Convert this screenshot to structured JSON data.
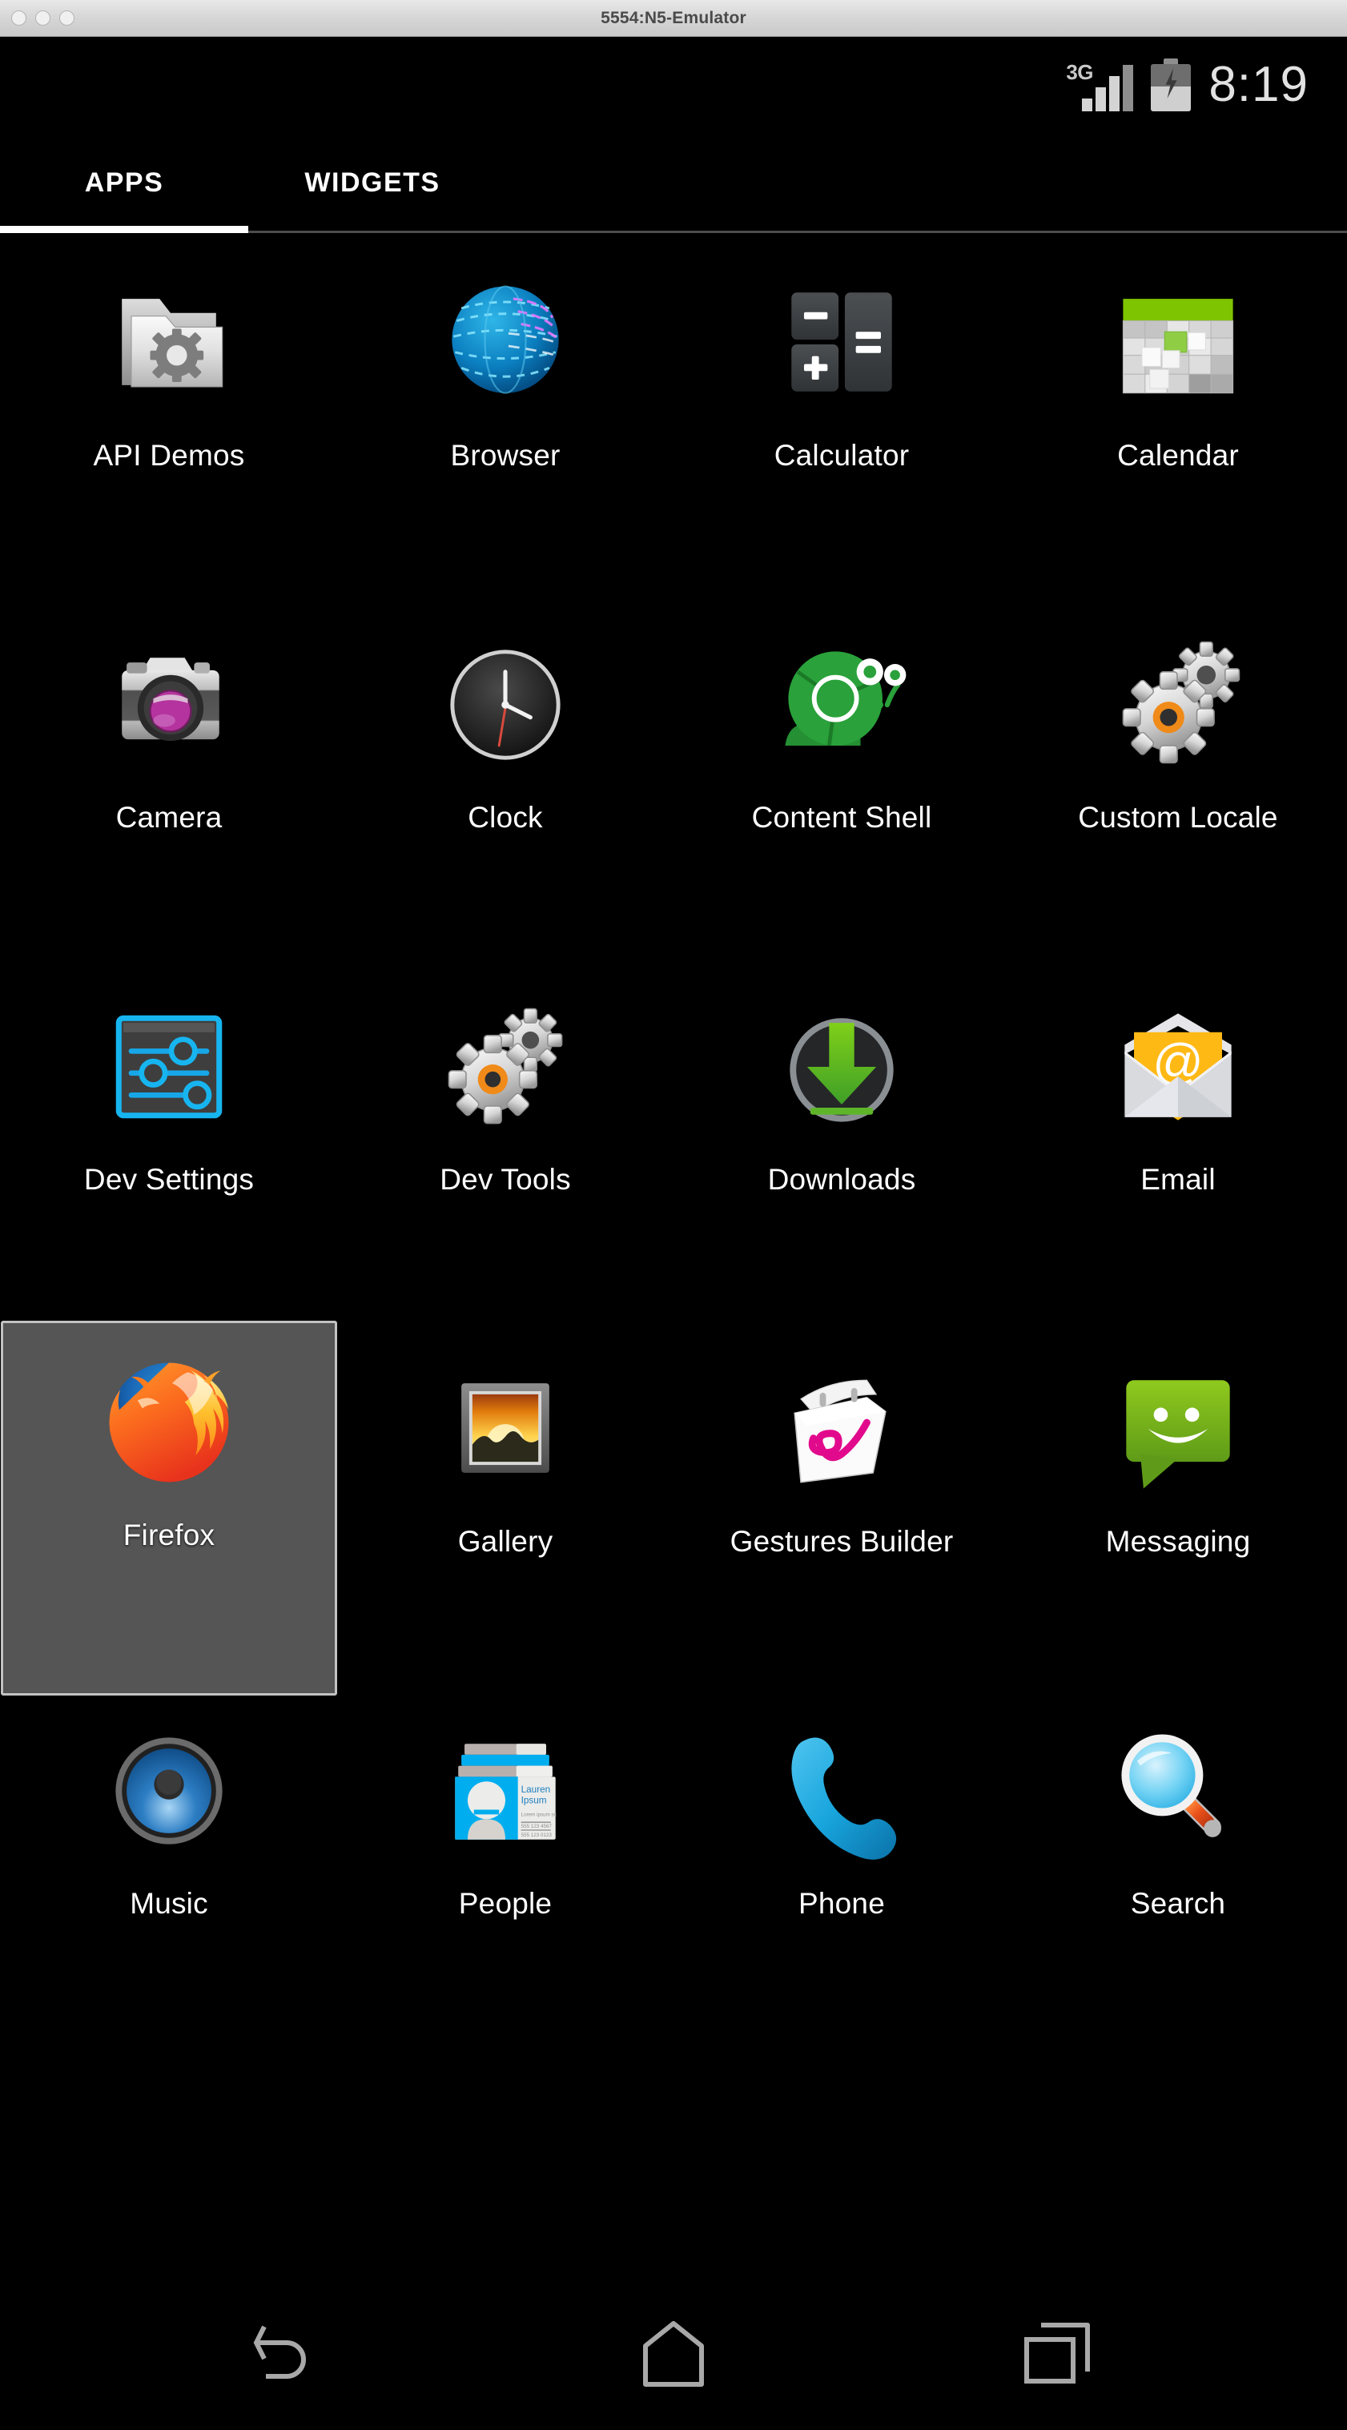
{
  "window": {
    "title": "5554:N5-Emulator",
    "traffic_lights": [
      "close",
      "minimize",
      "zoom"
    ]
  },
  "status_bar": {
    "network_label": "3G",
    "signal_bars_total": 4,
    "signal_bars_active": 3,
    "battery_charging": true,
    "battery_level_percent": 52,
    "time": "8:19"
  },
  "tabs": [
    {
      "label": "APPS",
      "selected": true
    },
    {
      "label": "WIDGETS",
      "selected": false
    }
  ],
  "apps": [
    {
      "label": "API Demos",
      "icon": "folder-gear-icon",
      "selected": false
    },
    {
      "label": "Browser",
      "icon": "blue-globe-icon",
      "selected": false
    },
    {
      "label": "Calculator",
      "icon": "calculator-keys-icon",
      "selected": false
    },
    {
      "label": "Calendar",
      "icon": "calendar-grid-icon",
      "selected": false
    },
    {
      "label": "Camera",
      "icon": "slr-camera-icon",
      "selected": false
    },
    {
      "label": "Clock",
      "icon": "analog-clock-icon",
      "selected": false
    },
    {
      "label": "Content Shell",
      "icon": "green-snail-icon",
      "selected": false
    },
    {
      "label": "Custom Locale",
      "icon": "gears-orange-icon",
      "selected": false
    },
    {
      "label": "Dev Settings",
      "icon": "blue-sliders-icon",
      "selected": false
    },
    {
      "label": "Dev Tools",
      "icon": "gears-orange-icon",
      "selected": false
    },
    {
      "label": "Downloads",
      "icon": "download-arrow-icon",
      "selected": false
    },
    {
      "label": "Email",
      "icon": "envelope-at-icon",
      "selected": false
    },
    {
      "label": "Firefox",
      "icon": "firefox-icon",
      "selected": true
    },
    {
      "label": "Gallery",
      "icon": "picture-frame-icon",
      "selected": false
    },
    {
      "label": "Gestures Builder",
      "icon": "gesture-notepad-icon",
      "selected": false
    },
    {
      "label": "Messaging",
      "icon": "green-speech-bubble-icon",
      "selected": false
    },
    {
      "label": "Music",
      "icon": "blue-speaker-icon",
      "selected": false
    },
    {
      "label": "People",
      "icon": "contact-card-icon",
      "selected": false
    },
    {
      "label": "Phone",
      "icon": "blue-handset-icon",
      "selected": false
    },
    {
      "label": "Search",
      "icon": "magnifier-icon",
      "selected": false
    }
  ],
  "people_icon_text": {
    "name_line1": "Lauren",
    "name_line2": "Ipsum"
  },
  "nav_bar": [
    {
      "name": "back",
      "icon": "back-arrow-icon"
    },
    {
      "name": "home",
      "icon": "home-pentagon-icon"
    },
    {
      "name": "recents",
      "icon": "recents-squares-icon"
    }
  ],
  "colors": {
    "background": "#000000",
    "titlebar": "#d9d9d9",
    "tab_active_underline": "#ffffff",
    "selection_fill": "#555555",
    "selection_border": "#c2c2c2",
    "status_text": "#e2e2e2",
    "android_green": "#8bc34a",
    "firefox_orange": "#e66000",
    "firefox_blue": "#1b6ec2"
  }
}
